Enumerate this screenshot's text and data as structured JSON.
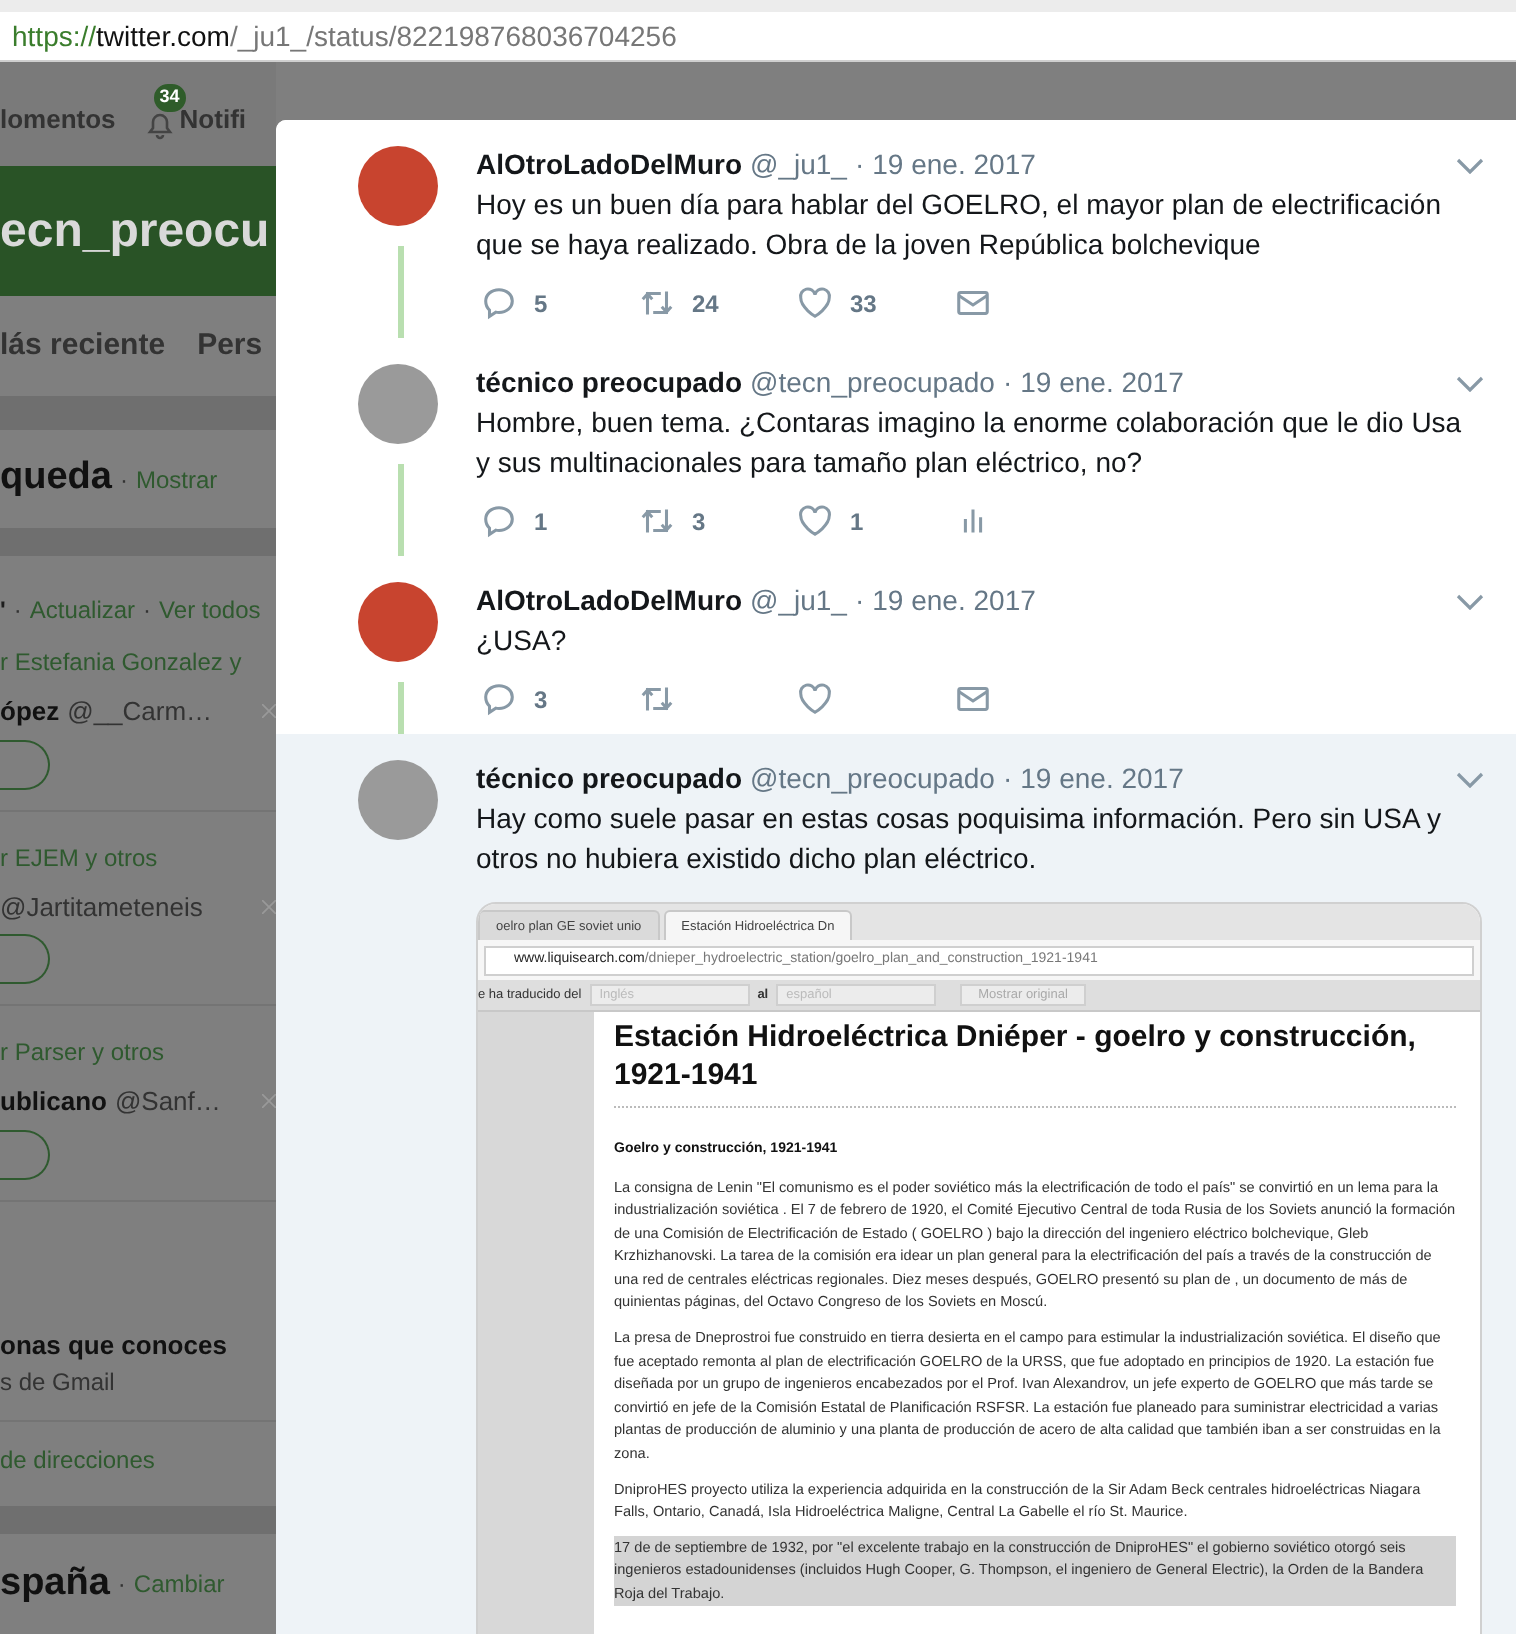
{
  "address_bar": {
    "scheme": "https://",
    "host": "twitter.com",
    "path": "/_ju1_/status/822198768036704256"
  },
  "background_page": {
    "nav": {
      "moments": "lomentos",
      "notifications_badge": "34",
      "notifications": "Notifi"
    },
    "profile_banner": "ecn_preocu",
    "tabs": [
      "lás reciente",
      "Pers"
    ],
    "search_card": {
      "title": "queda",
      "separator": "·",
      "link": "Mostrar"
    },
    "follow_card": {
      "header": [
        {
          "kind": "text",
          "text": "'"
        },
        {
          "kind": "separator",
          "text": "·"
        },
        {
          "kind": "link",
          "text": "Actualizar"
        },
        {
          "kind": "separator",
          "text": "·"
        },
        {
          "kind": "link",
          "text": "Ver todos"
        }
      ],
      "suggestions": [
        {
          "followed_by": "r Estefania Gonzalez y",
          "name": "ópez",
          "handle": "@__Carm…"
        },
        {
          "followed_by": "r EJEM y otros",
          "handle": "@Jartitameteneis"
        },
        {
          "followed_by": "r Parser y otros",
          "name": "ublicano",
          "handle": "@Sanf…"
        }
      ],
      "contacts_title": "onas que conoces",
      "contacts_subtitle": "s de Gmail",
      "contacts_link": "de direcciones"
    },
    "trends": {
      "title": "spaña",
      "separator": "·",
      "link": "Cambiar"
    }
  },
  "tweets": [
    {
      "name": "AlOtroLadoDelMuro",
      "handle": "@_ju1_",
      "separator": "·",
      "date": "19 ene. 2017",
      "text": "Hoy es un buen día para hablar del GOELRO, el mayor plan de electrificación que se haya realizado. Obra de la joven República bolchevique",
      "color": "#c8442f",
      "threaded": true,
      "highlighted": false,
      "actions": [
        {
          "kind": "reply",
          "count": "5"
        },
        {
          "kind": "retweet",
          "count": "24"
        },
        {
          "kind": "like",
          "count": "33"
        },
        {
          "kind": "message"
        }
      ]
    },
    {
      "name": "técnico preocupado",
      "handle": "@tecn_preocupado",
      "separator": "·",
      "date": "19 ene. 2017",
      "text": "Hombre, buen tema. ¿Contaras imagino la enorme colaboración que le dio Usa y sus multinacionales para tamaño plan eléctrico, no?",
      "color": "#9a9a9a",
      "threaded": true,
      "highlighted": false,
      "actions": [
        {
          "kind": "reply",
          "count": "1"
        },
        {
          "kind": "retweet",
          "count": "3"
        },
        {
          "kind": "like",
          "count": "1"
        },
        {
          "kind": "analytics"
        }
      ]
    },
    {
      "name": "AlOtroLadoDelMuro",
      "handle": "@_ju1_",
      "separator": "·",
      "date": "19 ene. 2017",
      "text": "¿USA?",
      "color": "#c8442f",
      "threaded": true,
      "highlighted": false,
      "actions": [
        {
          "kind": "reply",
          "count": "3"
        },
        {
          "kind": "retweet"
        },
        {
          "kind": "like"
        },
        {
          "kind": "message"
        }
      ]
    },
    {
      "name": "técnico preocupado",
      "handle": "@tecn_preocupado",
      "separator": "·",
      "date": "19 ene. 2017",
      "text": "Hay como suele pasar en estas cosas poquisima información. Pero sin USA y otros no hubiera existido dicho plan eléctrico.",
      "color": "#9a9a9a",
      "threaded": false,
      "highlighted": true,
      "attached_screenshot": {
        "tabs": [
          {
            "label": "oelro plan GE soviet unio",
            "selected": false
          },
          {
            "label": "Estación Hidroeléctrica Dn",
            "selected": true
          }
        ],
        "url": {
          "host": "www.liquisearch.com",
          "path": "/dnieper_hydroelectric_station/goelro_plan_and_construction_1921-1941"
        },
        "translate_bar": {
          "label": "e ha traducido del",
          "from": "Inglés",
          "joiner": "al",
          "to": "español",
          "button": "Mostrar original"
        },
        "heading": "Estación Hidroeléctrica Dniéper - goelro y construcción, 1921-1941",
        "subheading": "Goelro y construcción, 1921-1941",
        "paragraphs": [
          {
            "text": "La consigna de Lenin \"El comunismo es el poder soviético más la electrificación de todo el país\" se convirtió en un lema para la industrialización soviética . El 7 de febrero de 1920, el Comité Ejecutivo Central de toda Rusia de los Soviets anunció la formación de una Comisión de Electrificación de Estado ( GOELRO ) bajo la dirección del ingeniero eléctrico bolchevique, Gleb Krzhizhanovski. La tarea de la comisión era idear un plan general para la electrificación del país a través de la construcción de una red de centrales eléctricas regionales. Diez meses después, GOELRO presentó su plan de , un documento de más de quinientas páginas, del Octavo Congreso de los Soviets en Moscú.",
            "highlighted": false
          },
          {
            "text": "La presa de Dneprostroi fue construido en tierra desierta en el campo para estimular la industrialización soviética. El diseño que fue aceptado remonta al plan de electrificación GOELRO de la URSS, que fue adoptado en principios de 1920. La estación fue diseñada por un grupo de ingenieros encabezados por el Prof. Ivan Alexandrov, un jefe experto de GOELRO que más tarde se convirtió en jefe de la Comisión Estatal de Planificación RSFSR. La estación fue planeado para suministrar electricidad a varias plantas de producción de aluminio y una planta de producción de acero de alta calidad que también iban a ser construidas en la zona.",
            "highlighted": false
          },
          {
            "text": "DniproHES proyecto utiliza la experiencia adquirida en la construcción de la Sir Adam Beck centrales hidroeléctricas Niagara Falls, Ontario, Canadá, Isla Hidroeléctrica Maligne, Central La Gabelle el río St. Maurice.",
            "highlighted": false
          },
          {
            "text": "17 de de septiembre de 1932, por \"el excelente trabajo en la construcción de DniproHES\" el gobierno soviético otorgó seis ingenieros estadounidenses (incluidos Hugh Cooper, G. Thompson, el ingeniero de General Electric), la Orden de la Bandera Roja del Trabajo.",
            "highlighted": true
          }
        ]
      }
    }
  ]
}
